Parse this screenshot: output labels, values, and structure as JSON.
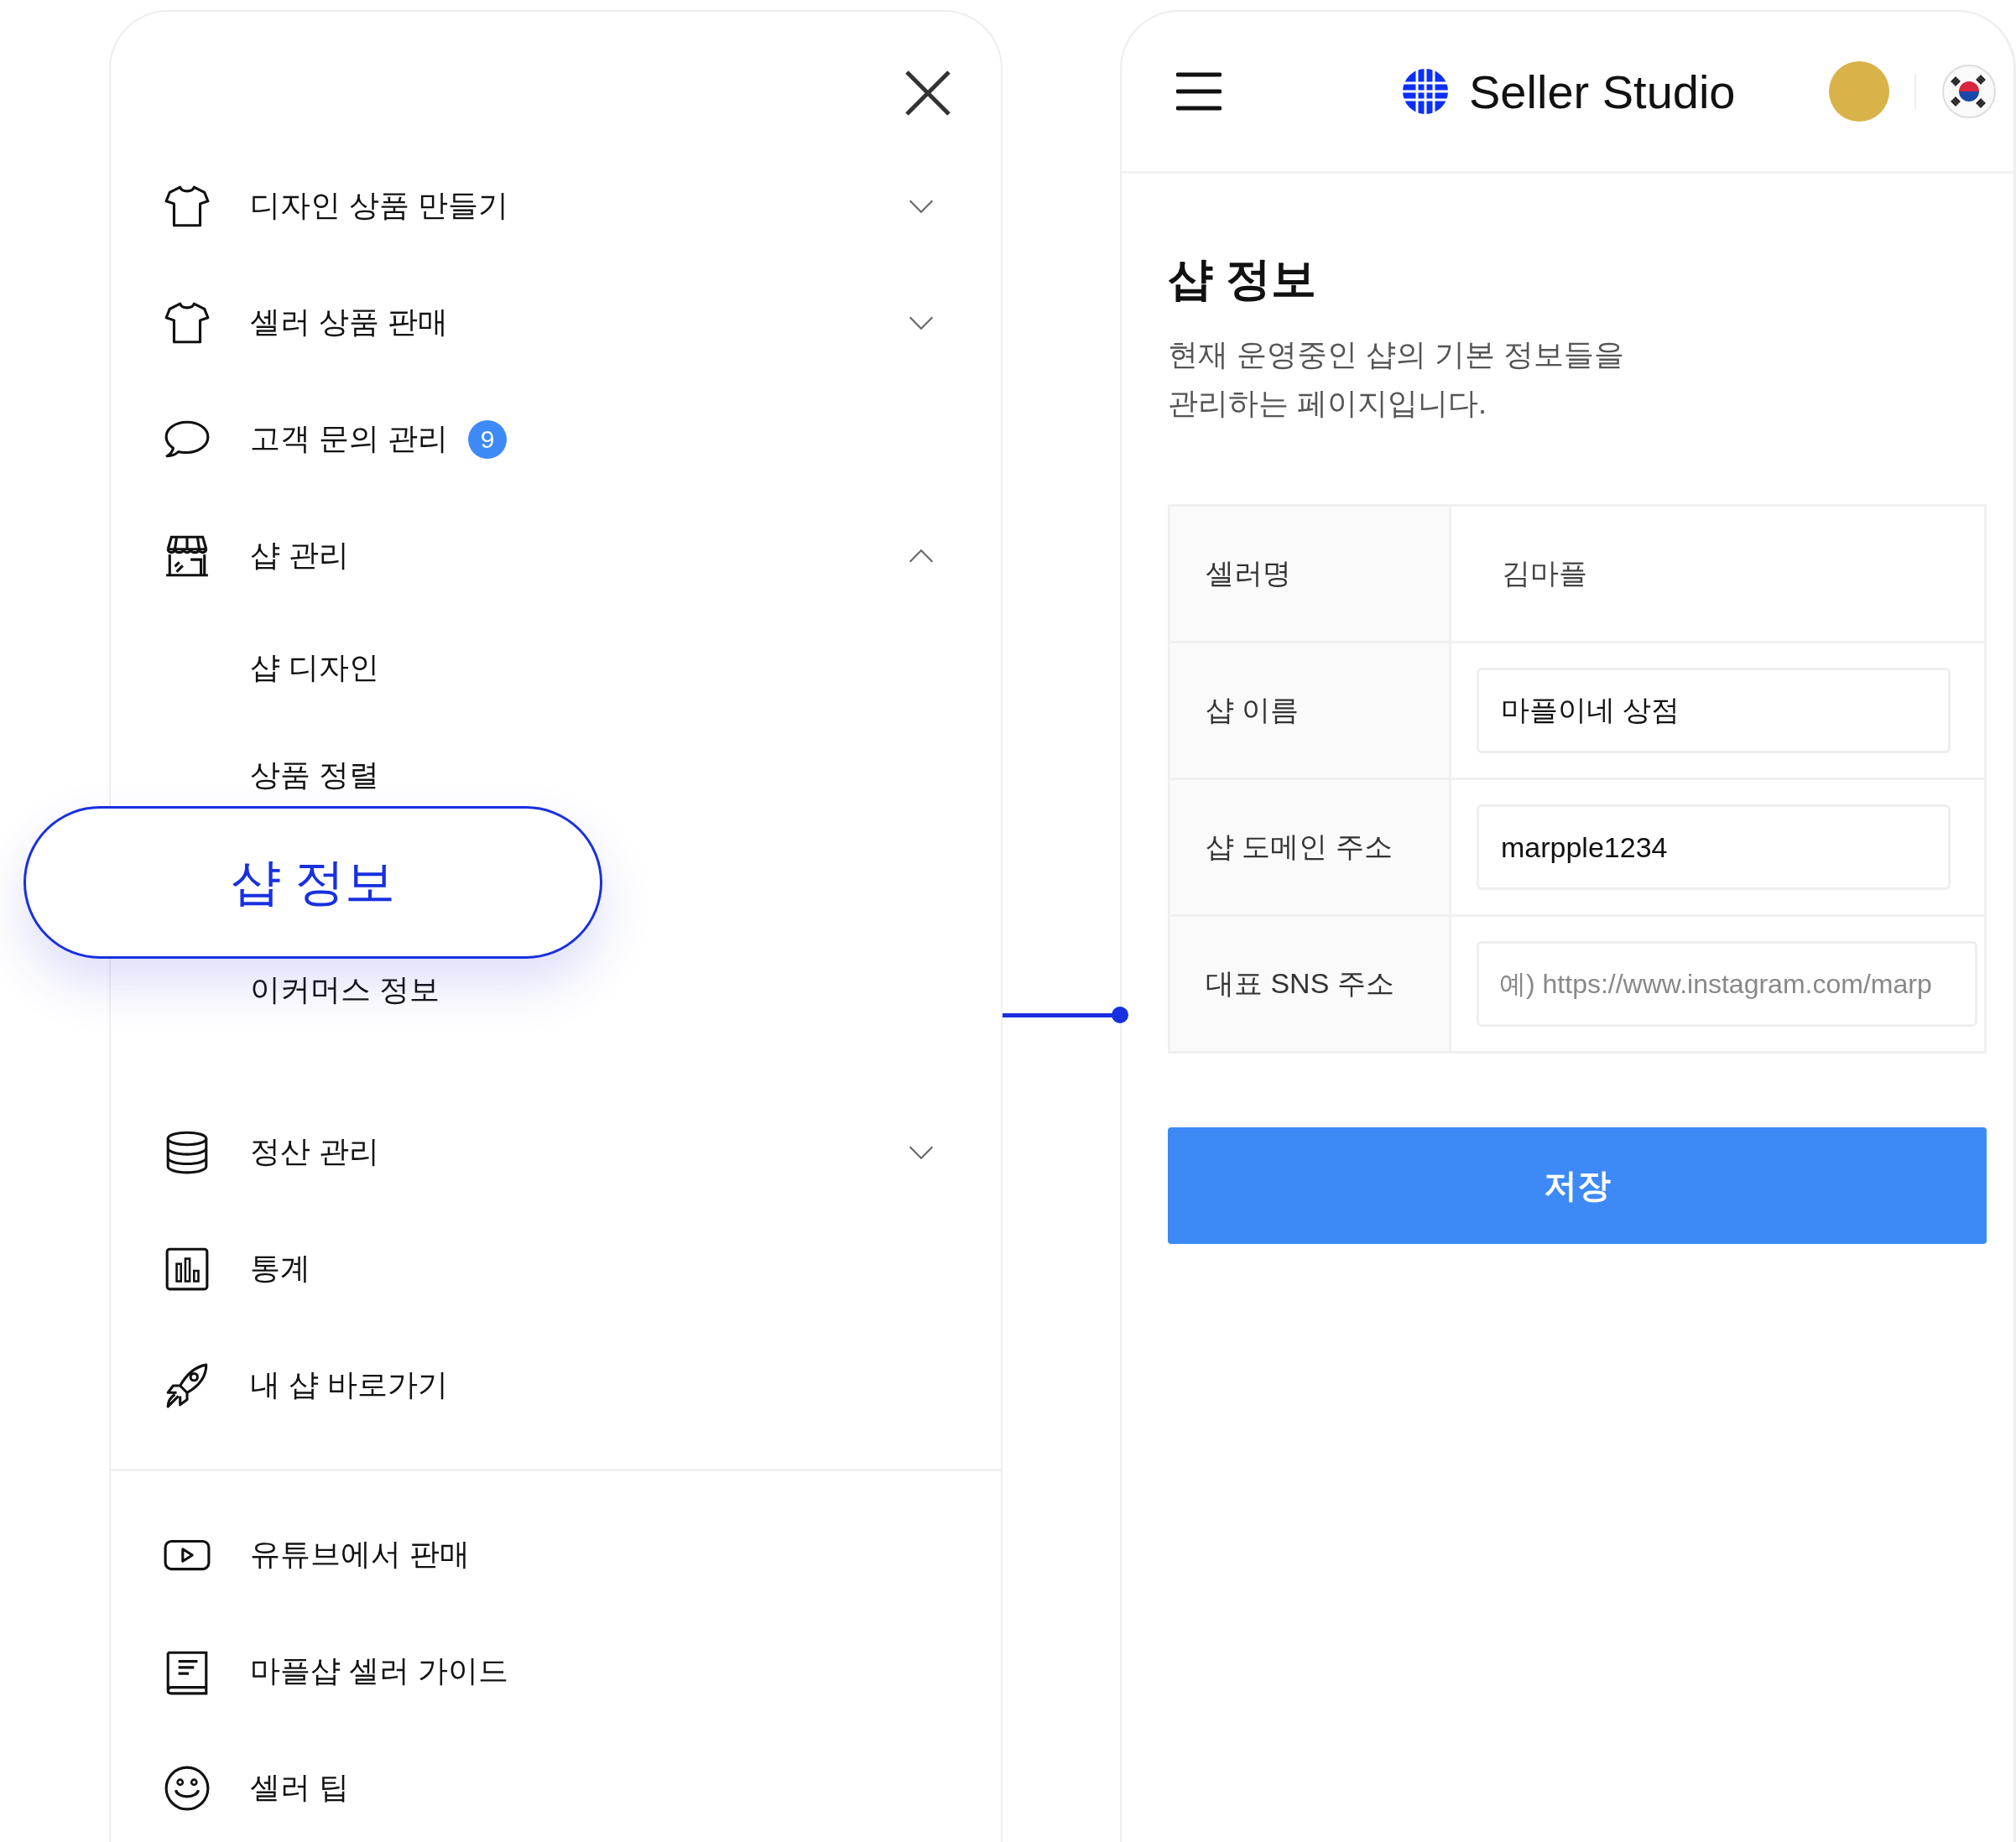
{
  "menu": {
    "sections": [
      {
        "items": [
          {
            "label": "디자인 상품 만들기",
            "expanded": false
          },
          {
            "label": "셀러 상품 판매",
            "expanded": false
          },
          {
            "label": "고객 문의 관리",
            "badge": "9"
          },
          {
            "label": "샵 관리",
            "expanded": true,
            "children": [
              {
                "label": "샵 디자인",
                "selected": false
              },
              {
                "label": "상품 정렬",
                "selected": false
              },
              {
                "label": "샵 정보",
                "selected": true
              },
              {
                "label": "이커머스 정보",
                "selected": false
              }
            ]
          },
          {
            "label": "정산 관리",
            "expanded": false
          },
          {
            "label": "통계"
          },
          {
            "label": "내 샵 바로가기"
          }
        ]
      },
      {
        "items": [
          {
            "label": "유튜브에서 판매"
          },
          {
            "label": "마플샵 셀러 가이드"
          },
          {
            "label": "셀러 팁"
          }
        ]
      }
    ]
  },
  "header": {
    "title": "Seller Studio"
  },
  "page": {
    "title": "샵 정보",
    "description": "현재 운영중인 샵의 기본 정보들을\n관리하는 페이지입니다.",
    "form": [
      {
        "label": "셀러명",
        "kind": "text",
        "value": "김마플"
      },
      {
        "label": "샵 이름",
        "kind": "input",
        "value": "마플이네 상점"
      },
      {
        "label": "샵 도메인 주소",
        "kind": "input",
        "value": "marpple1234"
      },
      {
        "label": "대표 SNS 주소",
        "kind": "input",
        "placeholder": "예) https://www.instagram.com/marp"
      }
    ],
    "button": "저장"
  }
}
